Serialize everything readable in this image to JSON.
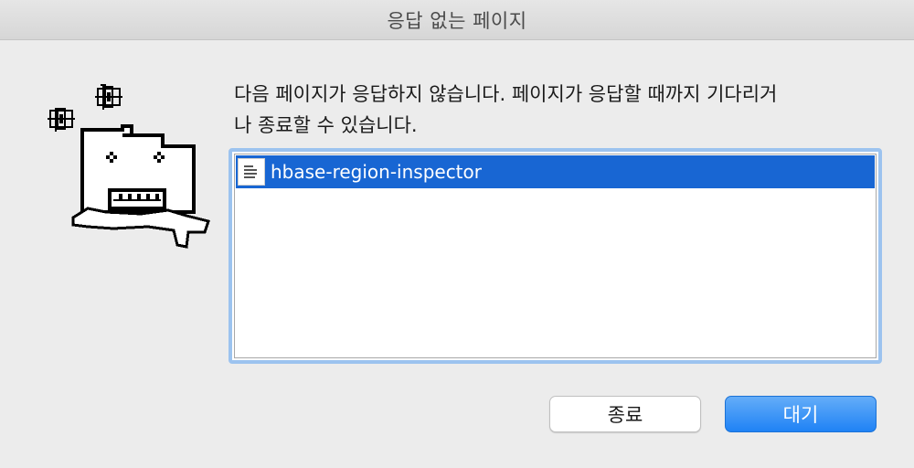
{
  "window": {
    "title": "응답 없는 페이지"
  },
  "dialog": {
    "message_line1": "다음 페이지가 응답하지 않습니다. 페이지가 응답할 때까지 기다리거",
    "message_line2": "나 종료할 수 있습니다.",
    "illustration_icon": "frozen-folder-icon"
  },
  "list": {
    "items": [
      {
        "label": "hbase-region-inspector",
        "icon": "page-icon",
        "selected": true
      }
    ]
  },
  "buttons": {
    "quit_label": "종료",
    "wait_label": "대기"
  },
  "colors": {
    "selection": "#1866d3",
    "focus_ring": "#9cc3ef",
    "default_button": "#1f82f5"
  }
}
